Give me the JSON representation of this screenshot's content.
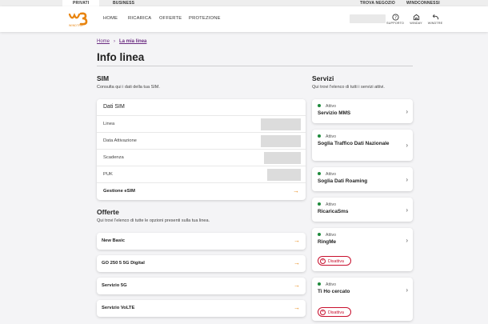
{
  "topbar": {
    "privati": "PRIVATI",
    "business": "BUSINESS",
    "trova_negozio": "TROVA NEGOZIO",
    "windconnessi": "WINDCONNESSI"
  },
  "header": {
    "logo_sub": "WINDTRE",
    "nav": [
      "HOME",
      "RICARICA",
      "OFFERTE",
      "PROTEZIONE"
    ],
    "icons": {
      "supporto": "SUPPORTO",
      "winday": "WINDAY",
      "windtre": "WINDTRE"
    }
  },
  "breadcrumb": {
    "home": "Home",
    "separator": "›",
    "current": "La mia linea"
  },
  "page_title": "Info linea",
  "sim": {
    "title": "SIM",
    "subtitle": "Consulta qui i dati della tua SIM.",
    "card_title": "Dati SIM",
    "rows": [
      "Linea",
      "Data Attivazione",
      "Scadenza",
      "PUK"
    ],
    "esim_label": "Gestione eSIM"
  },
  "offerte": {
    "title": "Offerte",
    "subtitle": "Qui trovi l'elenco di tutte le opzioni presenti sulla tua linea.",
    "items": [
      "New Basic",
      "GO 250 5 5G Digital",
      "Servizio 5G",
      "Servizio VoLTE"
    ]
  },
  "servizi": {
    "title": "Servizi",
    "subtitle": "Qui trovi l'elenco di tutti i servizi attivi.",
    "status_label": "Attivo",
    "items": [
      "Servizio MMS",
      "Soglia Traffico Dati Nazionale",
      "Soglia Dati Roaming",
      "RicaricaSms",
      "RingMe",
      "Ti Ho cercato"
    ],
    "deactivate_label": "Disattiva"
  },
  "colors": {
    "accent": "#e8840e",
    "link": "#6b2c82",
    "active": "#1e8a3c",
    "danger": "#c8102e"
  }
}
